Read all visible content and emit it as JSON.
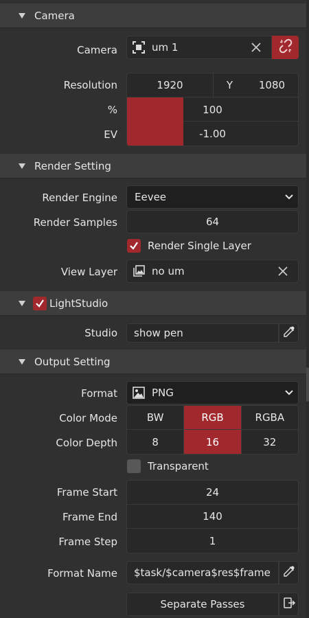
{
  "camera_panel": {
    "title": "Camera",
    "camera_label": "Camera",
    "camera_value": "um 1",
    "resolution_label": "Resolution",
    "resolution_x": "1920",
    "resolution_y_label": "Y",
    "resolution_y": "1080",
    "percent_label": "%",
    "percent_value": "100",
    "percent_fill": 0.33,
    "ev_label": "EV",
    "ev_value": "-1.00",
    "ev_fill": 0.33
  },
  "render_panel": {
    "title": "Render Setting",
    "engine_label": "Render Engine",
    "engine_value": "Eevee",
    "samples_label": "Render Samples",
    "samples_value": "64",
    "single_layer_label": "Render Single Layer",
    "single_layer_checked": true,
    "view_layer_label": "View Layer",
    "view_layer_value": "no um"
  },
  "lightstudio_panel": {
    "title": "LightStudio",
    "enabled": true,
    "studio_label": "Studio",
    "studio_value": "show pen"
  },
  "output_panel": {
    "title": "Output Setting",
    "format_label": "Format",
    "format_value": "PNG",
    "color_mode_label": "Color Mode",
    "color_modes": [
      "BW",
      "RGB",
      "RGBA"
    ],
    "color_mode_selected": "RGB",
    "color_depth_label": "Color Depth",
    "color_depths": [
      "8",
      "16",
      "32"
    ],
    "color_depth_selected": "16",
    "transparent_label": "Transparent",
    "transparent_checked": false,
    "frame_start_label": "Frame Start",
    "frame_start_value": "24",
    "frame_end_label": "Frame End",
    "frame_end_value": "140",
    "frame_step_label": "Frame Step",
    "frame_step_value": "1",
    "format_name_label": "Format Name",
    "format_name_value": "$task/$camera$res$frame",
    "separate_passes_label": "Separate Passes"
  },
  "colors": {
    "accent": "#a1292d",
    "background": "#303030",
    "field": "#282828",
    "header": "#3d3d3d"
  }
}
